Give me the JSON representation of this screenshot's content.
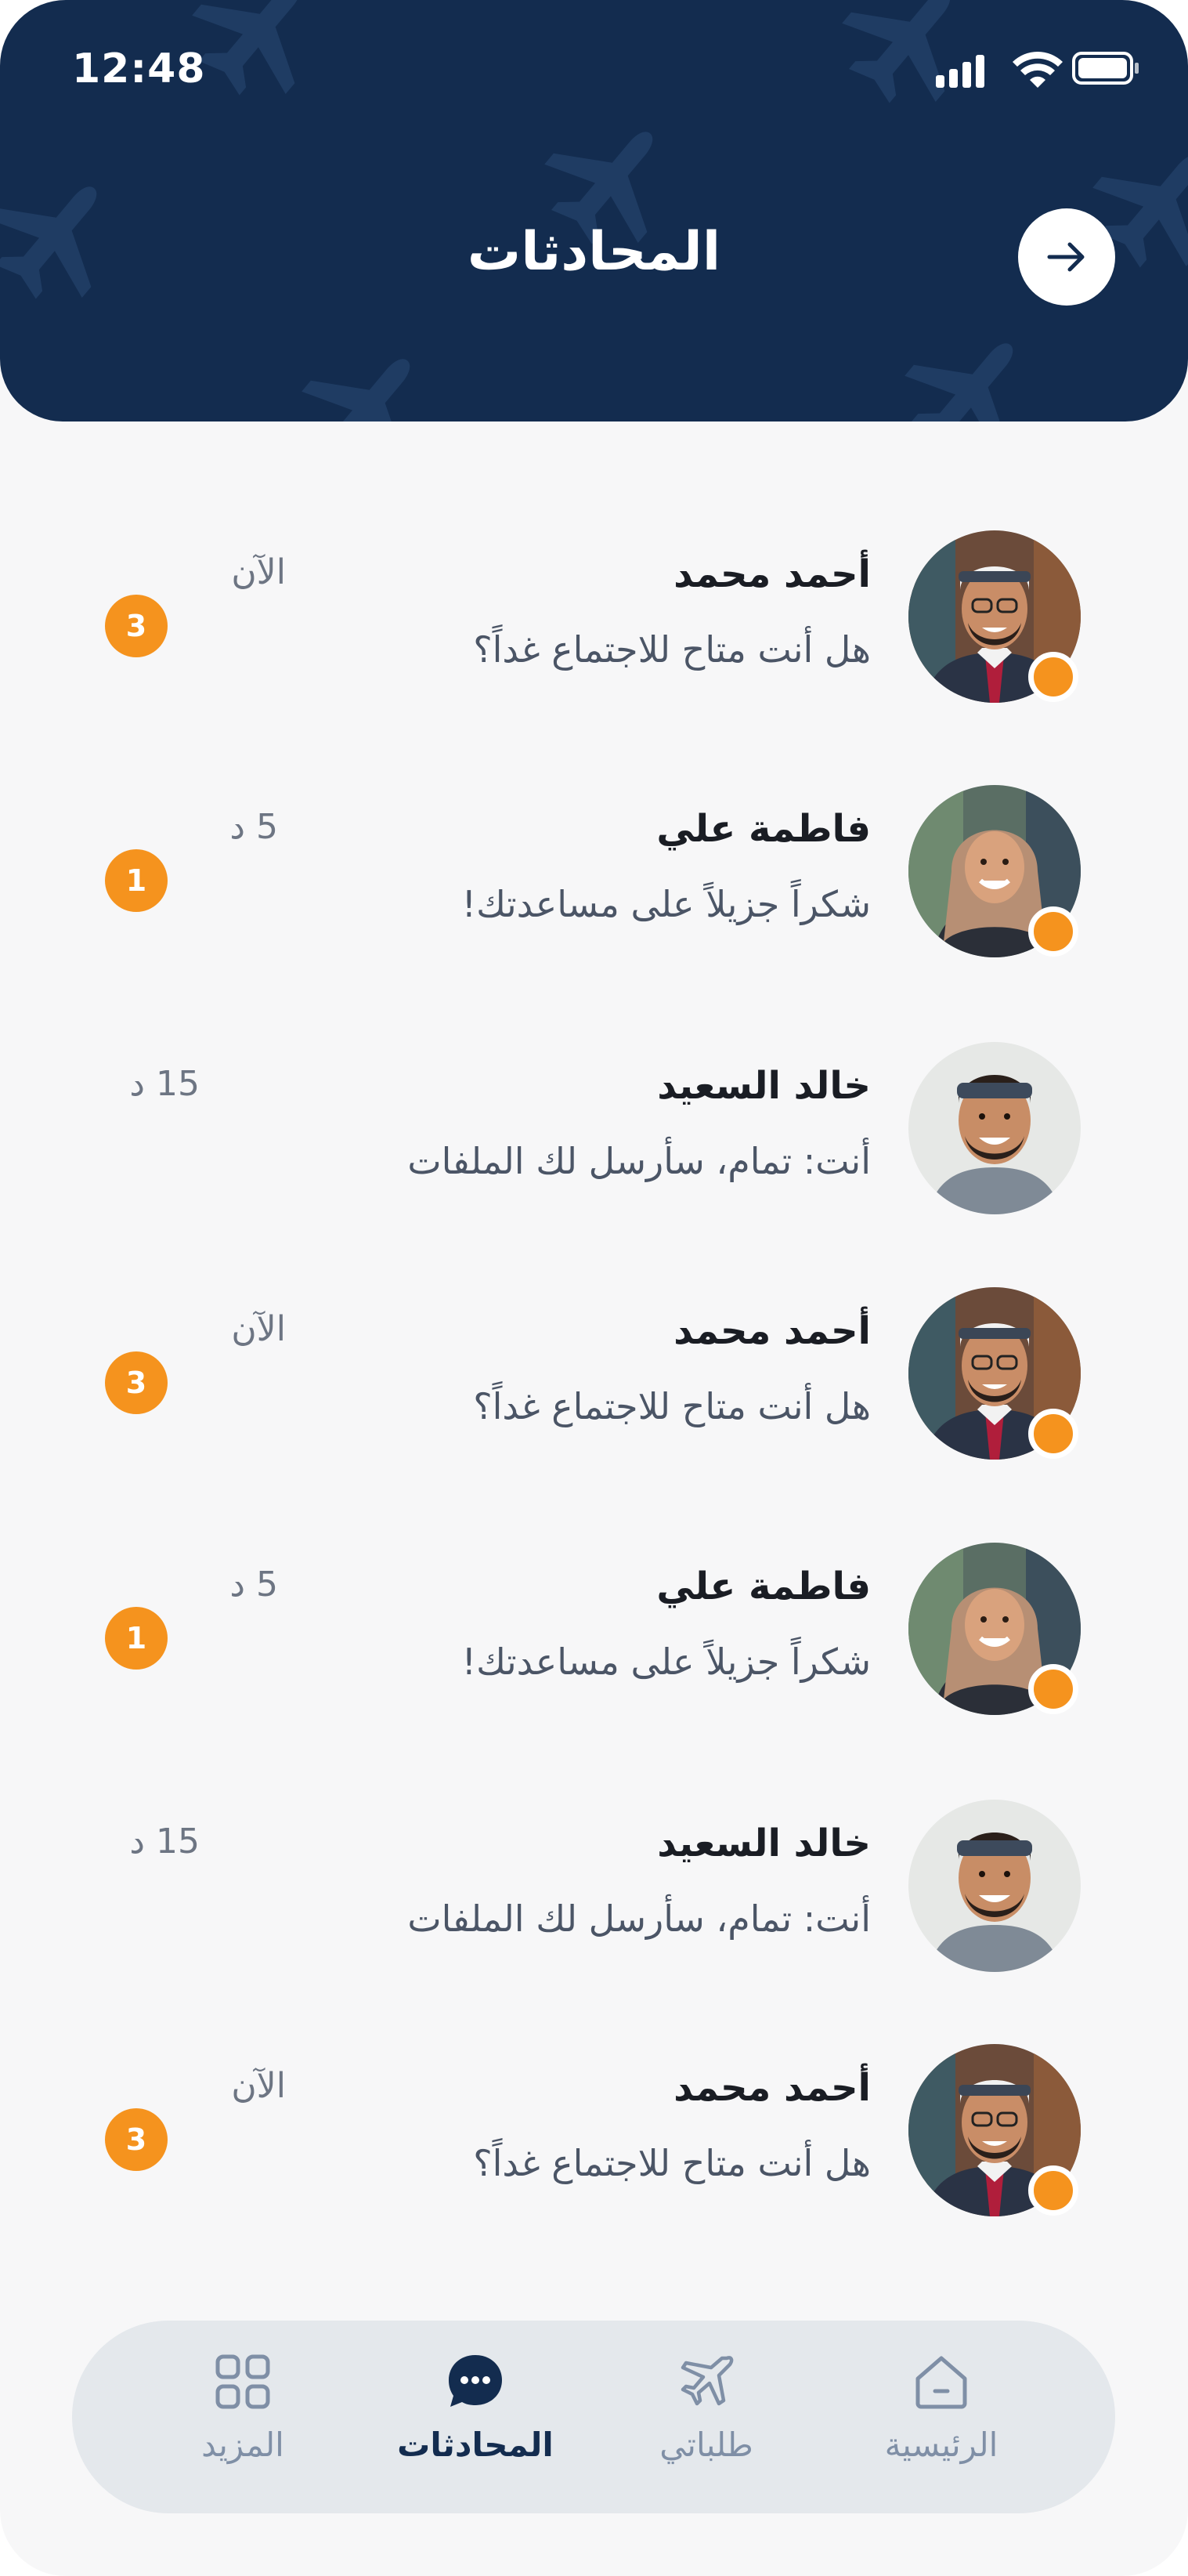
{
  "status_bar": {
    "time": "12:48"
  },
  "header": {
    "title": "المحادثات"
  },
  "chats": [
    {
      "name": "أحمد محمد",
      "preview": "هل أنت متاح للاجتماع غداً؟",
      "time": "الآن",
      "unread": "3",
      "online": true,
      "avatar": "man-ghutra"
    },
    {
      "name": "فاطمة علي",
      "preview": "شكراً جزيلاً على مساعدتك!",
      "time": "5 د",
      "unread": "1",
      "online": true,
      "avatar": "woman-hijab"
    },
    {
      "name": "خالد السعيد",
      "preview": "أنت: تمام، سأرسل لك الملفات",
      "time": "15 د",
      "unread": "",
      "online": false,
      "avatar": "man-headband"
    },
    {
      "name": "أحمد محمد",
      "preview": "هل أنت متاح للاجتماع غداً؟",
      "time": "الآن",
      "unread": "3",
      "online": true,
      "avatar": "man-ghutra"
    },
    {
      "name": "فاطمة علي",
      "preview": "شكراً جزيلاً على مساعدتك!",
      "time": "5 د",
      "unread": "1",
      "online": true,
      "avatar": "woman-hijab"
    },
    {
      "name": "خالد السعيد",
      "preview": "أنت: تمام، سأرسل لك الملفات",
      "time": "15 د",
      "unread": "",
      "online": false,
      "avatar": "man-headband"
    },
    {
      "name": "أحمد محمد",
      "preview": "هل أنت متاح للاجتماع غداً؟",
      "time": "الآن",
      "unread": "3",
      "online": true,
      "avatar": "man-ghutra"
    }
  ],
  "bottom_nav": [
    {
      "label": "المزيد",
      "icon": "grid-icon",
      "active": false
    },
    {
      "label": "المحادثات",
      "icon": "chat-bubble-icon",
      "active": true
    },
    {
      "label": "طلباتي",
      "icon": "airplane-icon",
      "active": false
    },
    {
      "label": "الرئيسية",
      "icon": "home-icon",
      "active": false
    }
  ],
  "colors": {
    "header_bg": "#132c4f",
    "accent": "#f5931e",
    "nav_bg": "#e4e8ec"
  }
}
